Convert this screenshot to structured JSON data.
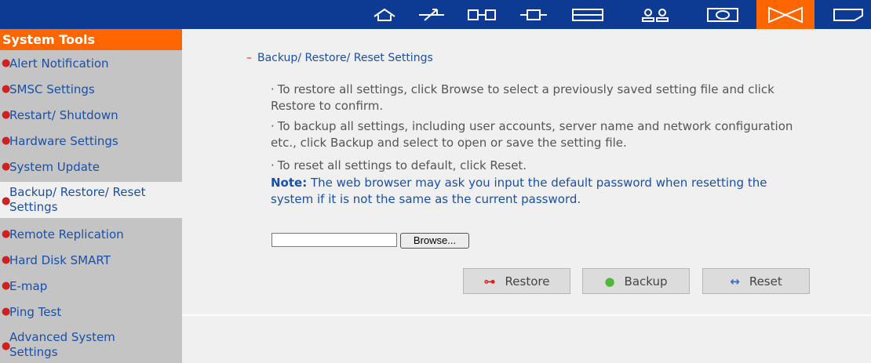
{
  "topbar": {
    "icons": [
      {
        "name": "home-icon"
      },
      {
        "name": "quick-config-icon"
      },
      {
        "name": "network-icon"
      },
      {
        "name": "device-icon"
      },
      {
        "name": "disk-icon"
      },
      {
        "name": "users-icon"
      },
      {
        "name": "share-icon"
      },
      {
        "name": "system-tools-icon",
        "active": true
      },
      {
        "name": "logs-icon"
      }
    ],
    "accent": "#ff6600",
    "background": "#0d3a92"
  },
  "sidebar": {
    "title": "System Tools",
    "items": [
      {
        "label": "Alert Notification"
      },
      {
        "label": "SMSC Settings"
      },
      {
        "label": "Restart/ Shutdown"
      },
      {
        "label": "Hardware Settings"
      },
      {
        "label": "System Update"
      },
      {
        "label": "Backup/ Restore/ Reset Settings",
        "active": true
      },
      {
        "label": "Remote Replication"
      },
      {
        "label": "Hard Disk SMART"
      },
      {
        "label": "E-map"
      },
      {
        "label": "Ping Test"
      },
      {
        "label": "Advanced System Settings"
      }
    ]
  },
  "main": {
    "title": "Backup/ Restore/ Reset Settings",
    "paragraphs": [
      "To restore all settings, click Browse to select a previously saved setting file and click Restore to confirm.",
      "To backup all settings, including user accounts, server name and network configuration etc., click Backup and select to open or save the setting file.",
      "To reset all settings to default, click Reset."
    ],
    "note_label": "Note:",
    "note_text": "The web browser may ask you input the default password when resetting the system if it is not the same as the current password.",
    "file_input_value": "",
    "browse_label": "Browse...",
    "buttons": {
      "restore": "Restore",
      "backup": "Backup",
      "reset": "Reset"
    }
  }
}
